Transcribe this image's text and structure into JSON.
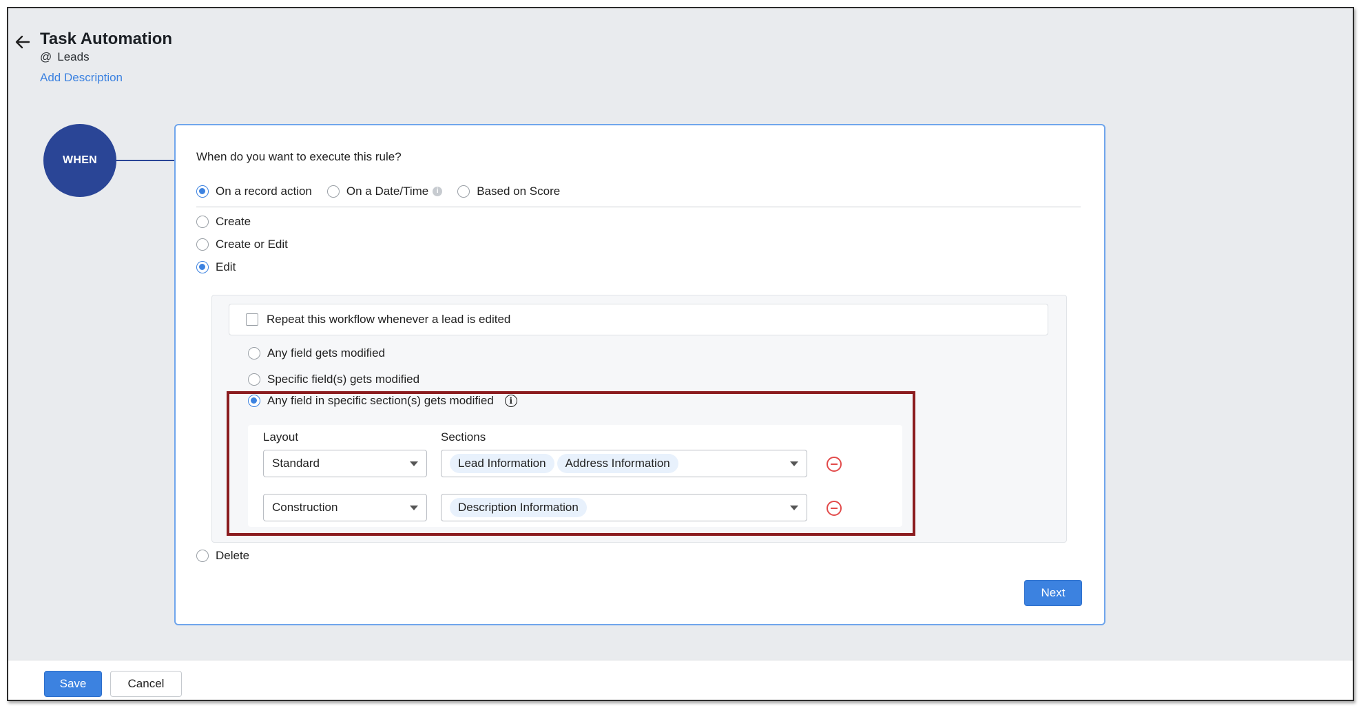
{
  "header": {
    "title": "Task Automation",
    "module_prefix": "@",
    "module": "Leads",
    "add_description": "Add Description"
  },
  "when_badge": "WHEN",
  "question": "When do you want to execute this rule?",
  "trigger_options": [
    {
      "label": "On a record action",
      "selected": true
    },
    {
      "label": "On a Date/Time",
      "selected": false
    },
    {
      "label": "Based on Score",
      "selected": false
    }
  ],
  "action_options": {
    "create": "Create",
    "create_or_edit": "Create or Edit",
    "edit": "Edit",
    "delete": "Delete",
    "selected": "Edit"
  },
  "repeat_label": "Repeat this workflow whenever a lead is edited",
  "repeat_checked": false,
  "modify_options": [
    {
      "label": "Any field gets modified",
      "selected": false
    },
    {
      "label": "Specific field(s) gets modified",
      "selected": false
    },
    {
      "label": "Any field in specific section(s) gets modified",
      "selected": true
    }
  ],
  "section_table": {
    "layout_header": "Layout",
    "sections_header": "Sections",
    "rows": [
      {
        "layout": "Standard",
        "sections": [
          "Lead Information",
          "Address Information"
        ]
      },
      {
        "layout": "Construction",
        "sections": [
          "Description Information"
        ]
      }
    ]
  },
  "buttons": {
    "next": "Next",
    "save": "Save",
    "cancel": "Cancel"
  },
  "colors": {
    "accent": "#3c82e0",
    "when_badge": "#2a4596",
    "highlight_border": "#8b1c1f",
    "remove": "#e24a4a"
  }
}
